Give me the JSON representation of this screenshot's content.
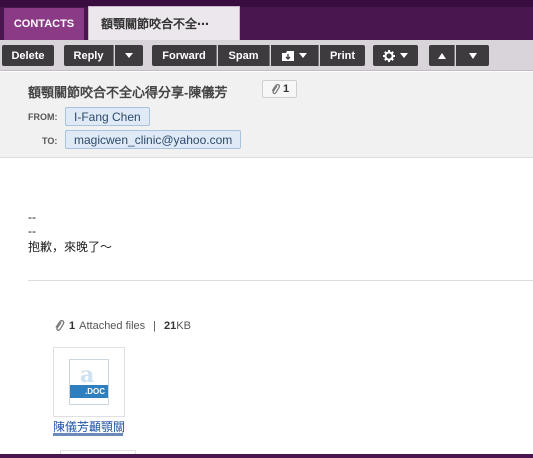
{
  "tabs": {
    "contacts_label": "CONTACTS",
    "active_label": "額顎關節咬合不全⋯"
  },
  "toolbar": {
    "delete_label": "Delete",
    "reply_label": "Reply",
    "forward_label": "Forward",
    "spam_label": "Spam",
    "print_label": "Print"
  },
  "message": {
    "subject": "額顎關節咬合不全心得分享-陳儀芳",
    "attachment_count_badge": "1",
    "from_label": "FROM:",
    "from_value": "I-Fang Chen",
    "to_label": "TO:",
    "to_value": "magicwen_clinic@yahoo.com"
  },
  "body": {
    "line1": "--",
    "line2": "--",
    "line3": "抱歉，來晚了～"
  },
  "attachments": {
    "count": "1",
    "label": "Attached files",
    "separator": "|",
    "size_num": "21",
    "size_unit": "KB",
    "file_badge": ".DOC",
    "file_name": "陳儀芳顳顎關"
  },
  "colors": {
    "tabbar": "#4a1650",
    "contacts_tab": "#8b3a86",
    "toolbar_btn": "#3d3b3e",
    "chip_bg": "#dfeaf6",
    "link": "#2254a8"
  }
}
